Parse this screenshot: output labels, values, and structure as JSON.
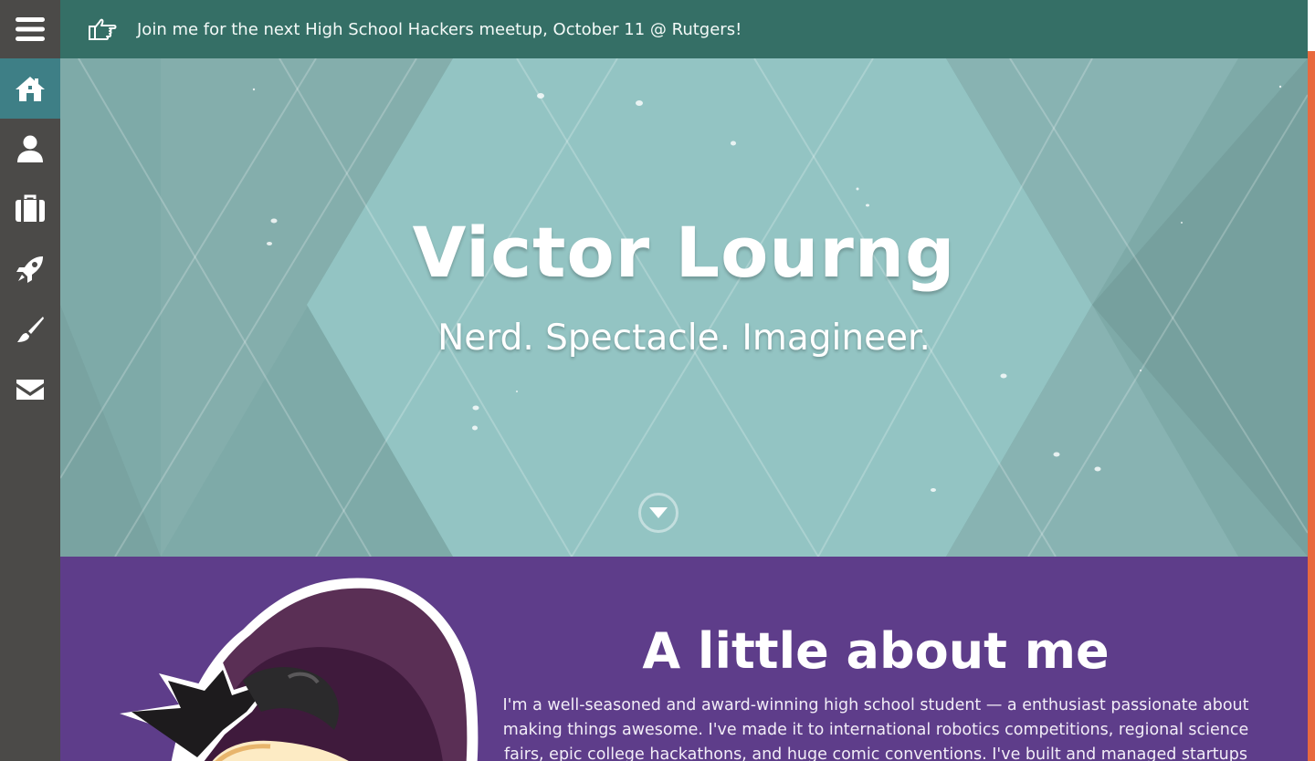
{
  "sidebar": {
    "menu_icon": "hamburger-menu-icon",
    "items": [
      {
        "name": "home",
        "icon": "home-icon",
        "active": true
      },
      {
        "name": "about",
        "icon": "user-icon",
        "active": false
      },
      {
        "name": "work",
        "icon": "briefcase-icon",
        "active": false
      },
      {
        "name": "projects",
        "icon": "rocket-icon",
        "active": false
      },
      {
        "name": "art",
        "icon": "paintbrush-icon",
        "active": false
      },
      {
        "name": "contact",
        "icon": "envelope-icon",
        "active": false
      }
    ]
  },
  "announcement": {
    "icon": "pointing-hand-icon",
    "text": "Join me for the next High School Hackers meetup, October 11 @ Rutgers!"
  },
  "hero": {
    "name": "Victor Lourng",
    "tagline": "Nerd. Spectacle. Imagineer.",
    "scroll_icon": "chevron-down-icon"
  },
  "about": {
    "heading": "A little about me",
    "body": "I'm a well-seasoned and award-winning high school student — a enthusiast passionate about making things awesome. I've made it to international robotics competitions, regional science fairs, epic college hackathons, and huge comic conventions. I've built and managed startups from ideas"
  },
  "colors": {
    "sidebar": "#4b4a48",
    "sidebar_active": "#3e7f86",
    "topbar": "#356f66",
    "hero": "#93c4c3",
    "about": "#5e3d8a",
    "accent": "#e8693e"
  }
}
